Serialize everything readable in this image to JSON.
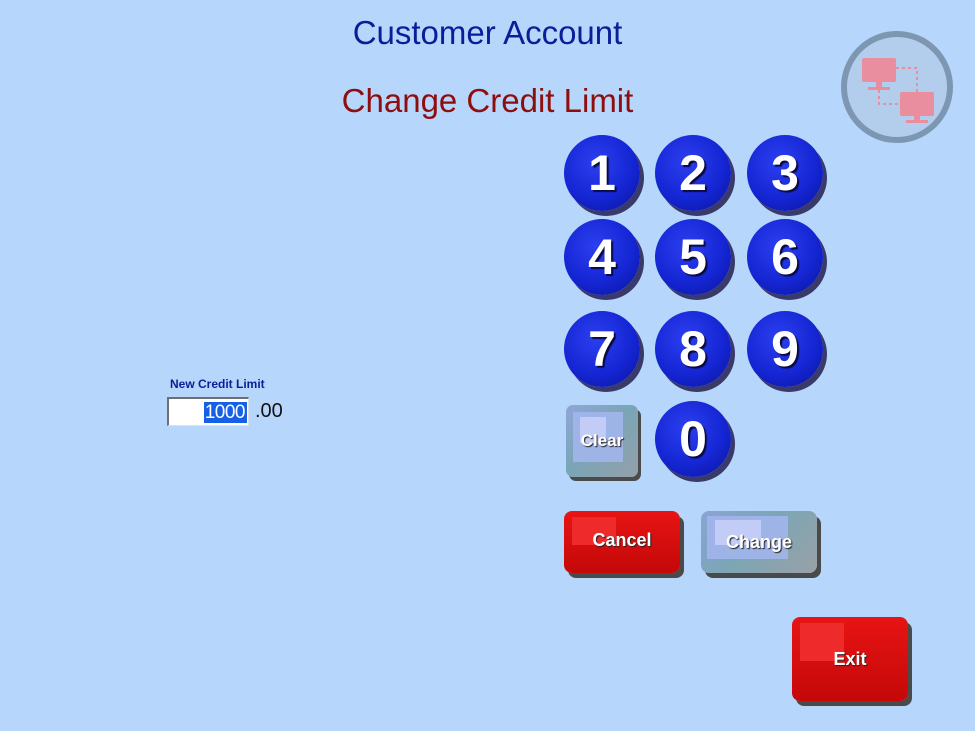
{
  "header": {
    "title": "Customer Account",
    "subtitle": "Change Credit Limit"
  },
  "status": {
    "network_icon": "network-computers-icon"
  },
  "form": {
    "credit_limit_label": "New Credit Limit",
    "credit_limit_value": "1000",
    "credit_limit_suffix": ".00"
  },
  "keypad": {
    "keys": [
      "1",
      "2",
      "3",
      "4",
      "5",
      "6",
      "7",
      "8",
      "9",
      "0"
    ],
    "clear_label": "Clear"
  },
  "actions": {
    "cancel_label": "Cancel",
    "change_label": "Change",
    "exit_label": "Exit"
  },
  "colors": {
    "background": "#b7d6fb",
    "title": "#0b1d99",
    "subtitle": "#8e0d0d",
    "key_blue": "#1526d4",
    "button_red": "#d40d0d",
    "selection": "#1560e6"
  }
}
